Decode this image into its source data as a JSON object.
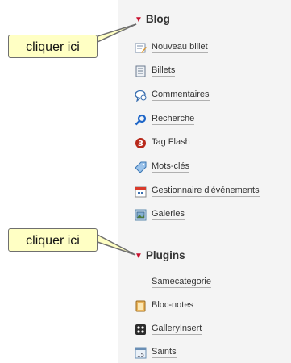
{
  "callouts": {
    "top": "cliquer ici",
    "bottom": "cliquer ici"
  },
  "blog": {
    "title": "Blog",
    "items": [
      {
        "label": "Nouveau billet",
        "icon": "new-post-icon"
      },
      {
        "label": "Billets",
        "icon": "posts-icon"
      },
      {
        "label": "Commentaires",
        "icon": "comments-icon"
      },
      {
        "label": "Recherche",
        "icon": "search-icon"
      },
      {
        "label": "Tag Flash",
        "icon": "tag-flash-icon"
      },
      {
        "label": "Mots-clés",
        "icon": "tag-icon"
      },
      {
        "label": "Gestionnaire d'événements",
        "icon": "calendar-icon"
      },
      {
        "label": "Galeries",
        "icon": "gallery-icon"
      }
    ]
  },
  "plugins": {
    "title": "Plugins",
    "items": [
      {
        "label": "Samecategorie",
        "icon": ""
      },
      {
        "label": "Bloc-notes",
        "icon": "notepad-icon"
      },
      {
        "label": "GalleryInsert",
        "icon": "gallery-insert-icon"
      },
      {
        "label": "Saints",
        "icon": "calendar-page-icon"
      }
    ]
  },
  "colors": {
    "triangle": "#c8102e",
    "callout_bg": "#ffffc4",
    "sidebar_bg": "#f4f4f4"
  }
}
